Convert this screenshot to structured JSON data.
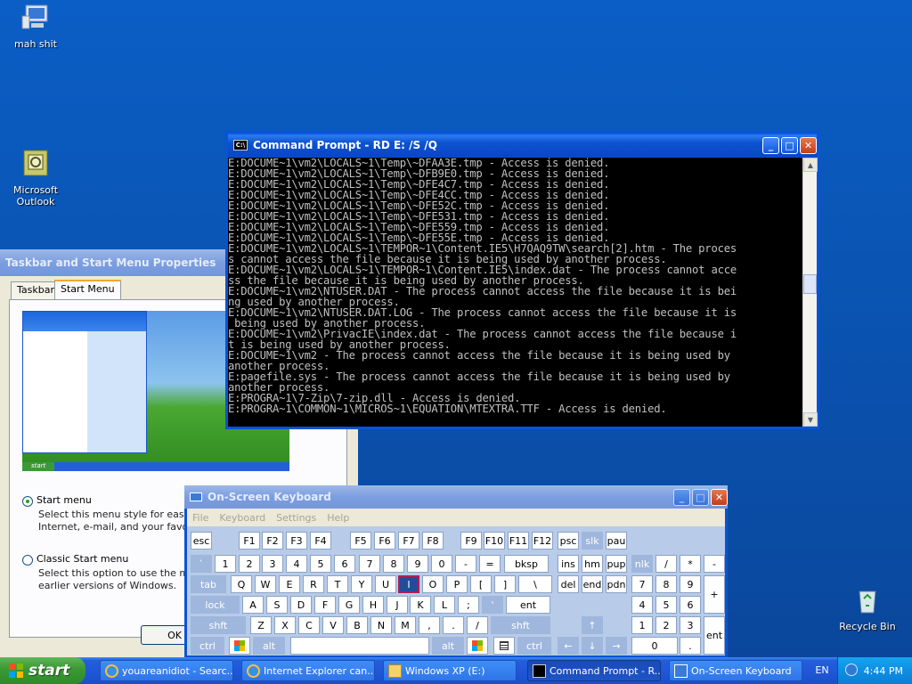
{
  "desktop": {
    "icons": [
      {
        "label": "mah shit",
        "icon": "computer-icon"
      },
      {
        "label": "Microsoft Outlook",
        "icon": "outlook-icon"
      },
      {
        "label": "Recycle Bin",
        "icon": "recycle-bin-icon"
      }
    ]
  },
  "taskbar_props": {
    "title": "Taskbar and Start Menu Properties",
    "tabs": [
      "Taskbar",
      "Start Menu"
    ],
    "options": [
      {
        "label": "Start menu",
        "desc1": "Select this menu style for easy acc",
        "desc2": "Internet, e-mail, and your favorite p"
      },
      {
        "label": "Classic Start menu",
        "desc1": "Select this option to use the menu",
        "desc2": "earlier versions of Windows."
      }
    ],
    "ok_label": "OK",
    "preview_start": "start"
  },
  "cmd": {
    "title": "Command Prompt - RD E: /S /Q",
    "lines": [
      "E:DOCUME~1\\vm2\\LOCALS~1\\Temp\\~DFAA3E.tmp - Access is denied.",
      "E:DOCUME~1\\vm2\\LOCALS~1\\Temp\\~DFB9E0.tmp - Access is denied.",
      "E:DOCUME~1\\vm2\\LOCALS~1\\Temp\\~DFE4C7.tmp - Access is denied.",
      "E:DOCUME~1\\vm2\\LOCALS~1\\Temp\\~DFE4CC.tmp - Access is denied.",
      "E:DOCUME~1\\vm2\\LOCALS~1\\Temp\\~DFE52C.tmp - Access is denied.",
      "E:DOCUME~1\\vm2\\LOCALS~1\\Temp\\~DFE531.tmp - Access is denied.",
      "E:DOCUME~1\\vm2\\LOCALS~1\\Temp\\~DFE559.tmp - Access is denied.",
      "E:DOCUME~1\\vm2\\LOCALS~1\\Temp\\~DFE55E.tmp - Access is denied.",
      "E:DOCUME~1\\vm2\\LOCALS~1\\TEMPOR~1\\Content.IE5\\H7QAQ9TW\\search[2].htm - The proces",
      "s cannot access the file because it is being used by another process.",
      "E:DOCUME~1\\vm2\\LOCALS~1\\TEMPOR~1\\Content.IE5\\index.dat - The process cannot acce",
      "ss the file because it is being used by another process.",
      "E:DOCUME~1\\vm2\\NTUSER.DAT - The process cannot access the file because it is bei",
      "ng used by another process.",
      "E:DOCUME~1\\vm2\\NTUSER.DAT.LOG - The process cannot access the file because it is",
      " being used by another process.",
      "E:DOCUME~1\\vm2\\PrivacIE\\index.dat - The process cannot access the file because i",
      "t is being used by another process.",
      "E:DOCUME~1\\vm2 - The process cannot access the file because it is being used by",
      "another process.",
      "E:pagefile.sys - The process cannot access the file because it is being used by",
      "another process.",
      "E:PROGRA~1\\7-Zip\\7-zip.dll - Access is denied.",
      "E:PROGRA~1\\COMMON~1\\MICROS~1\\EQUATION\\MTEXTRA.TTF - Access is denied."
    ]
  },
  "osk": {
    "title": "On-Screen Keyboard",
    "menu": [
      "File",
      "Keyboard",
      "Settings",
      "Help"
    ],
    "rows": [
      [
        "esc",
        "F1",
        "F2",
        "F3",
        "F4",
        "F5",
        "F6",
        "F7",
        "F8",
        "F9",
        "F10",
        "F11",
        "F12",
        "psc",
        "slk",
        "pau"
      ],
      [
        "`",
        "1",
        "2",
        "3",
        "4",
        "5",
        "6",
        "7",
        "8",
        "9",
        "0",
        "-",
        "=",
        "bksp",
        "ins",
        "hm",
        "pup",
        "nlk",
        "/",
        "*",
        "-"
      ],
      [
        "tab",
        "Q",
        "W",
        "E",
        "R",
        "T",
        "Y",
        "U",
        "I",
        "O",
        "P",
        "[",
        "]",
        "\\",
        "del",
        "end",
        "pdn",
        "7",
        "8",
        "9",
        "+"
      ],
      [
        "lock",
        "A",
        "S",
        "D",
        "F",
        "G",
        "H",
        "J",
        "K",
        "L",
        ";",
        "'",
        "ent",
        "4",
        "5",
        "6"
      ],
      [
        "shft",
        "Z",
        "X",
        "C",
        "V",
        "B",
        "N",
        "M",
        ",",
        ".",
        "/",
        "shft",
        "↑",
        "1",
        "2",
        "3",
        "ent"
      ],
      [
        "ctrl",
        "alt",
        "alt",
        "ctrl",
        "←",
        "↓",
        "→",
        "0",
        "."
      ]
    ]
  },
  "taskbar": {
    "start_label": "start",
    "items": [
      {
        "label": "youareanidiot - Searc...",
        "icon": "ie-icon"
      },
      {
        "label": "Internet Explorer can...",
        "icon": "ie-icon"
      },
      {
        "label": "Windows XP (E:)",
        "icon": "folder-icon"
      },
      {
        "label": "Command Prompt - R...",
        "icon": "cmd-icon"
      },
      {
        "label": "On-Screen Keyboard",
        "icon": "keyboard-icon"
      }
    ],
    "lang": "EN",
    "clock": "4:44 PM"
  },
  "colors": {
    "desktop": "#0a56b6",
    "taskbar": "#245edb",
    "start": "#3c9a36",
    "tray": "#0d8fe3",
    "cmd_bg": "#000000",
    "cmd_text": "#c0c0c0"
  }
}
